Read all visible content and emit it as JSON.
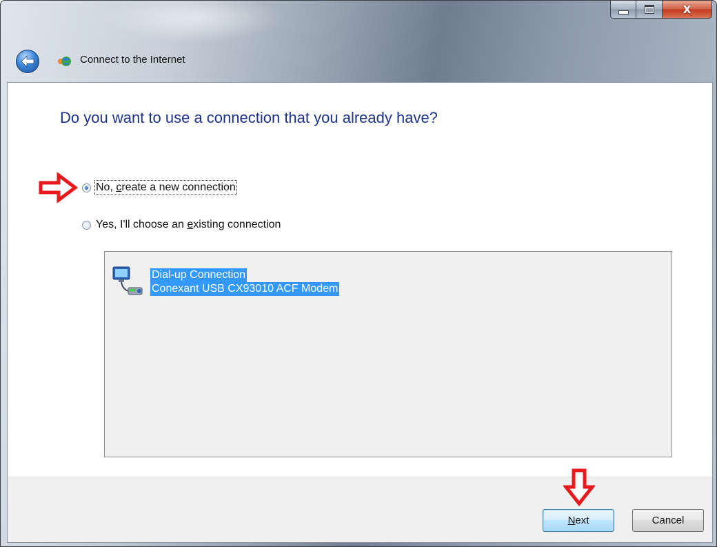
{
  "window": {
    "title": "Connect to the Internet",
    "caption_buttons": {
      "minimize_icon": "minimize-icon",
      "maximize_icon": "maximize-icon",
      "close_label": "X"
    }
  },
  "page": {
    "question": "Do you want to use a connection that you already have?"
  },
  "options": [
    {
      "label_prefix": "No, ",
      "accesskey": "c",
      "label_suffix": "reate a new connection",
      "checked": true
    },
    {
      "label_prefix": "Yes, I'll choose an ",
      "accesskey": "e",
      "label_suffix": "xisting connection",
      "checked": false
    }
  ],
  "connections": [
    {
      "name": "Dial-up Connection",
      "device": "Conexant USB CX93010 ACF Modem",
      "selected": true,
      "icon": "dialup-connection-icon"
    }
  ],
  "buttons": {
    "next_accesskey": "N",
    "next_rest": "ext",
    "cancel": "Cancel"
  },
  "annotations": {
    "arrow_color": "#e8191d"
  },
  "colors": {
    "question_text": "#1e3287",
    "selection_bg": "#3399ff"
  }
}
